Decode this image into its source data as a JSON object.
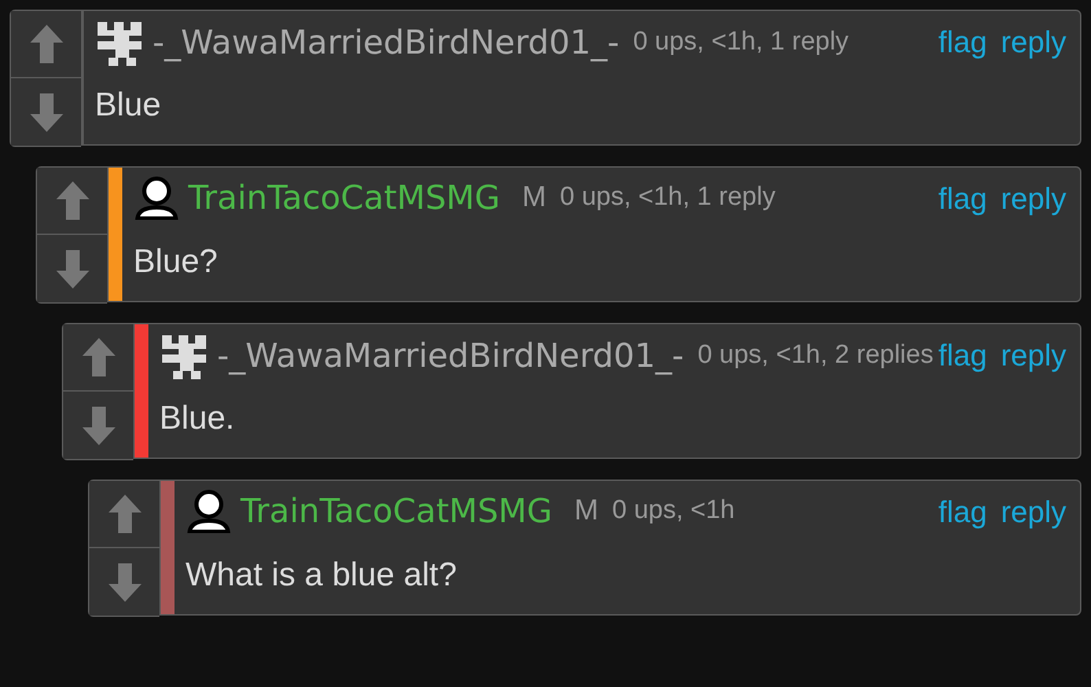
{
  "comments": [
    {
      "author": {
        "name": "-_WawaMarriedBirdNerd01_-",
        "kind": "pattern"
      },
      "meta": "0 ups, <1h, 1 reply",
      "actions": [
        "flag",
        "reply"
      ],
      "text": "Blue",
      "children": [
        {
          "author": {
            "name": "TrainTacoCatMSMG",
            "kind": "person"
          },
          "badge": "M",
          "color": "#f7931e",
          "meta": "0 ups, <1h, 1 reply",
          "actions": [
            "flag",
            "reply"
          ],
          "text": "Blue?",
          "children": [
            {
              "author": {
                "name": "-_WawaMarriedBirdNerd01_-",
                "kind": "pattern"
              },
              "color": "#f23a35",
              "meta": "0 ups, <1h, 2 replies",
              "actions": [
                "flag",
                "reply"
              ],
              "text": "Blue.",
              "children": [
                {
                  "author": {
                    "name": "TrainTacoCatMSMG",
                    "kind": "person"
                  },
                  "badge": "M",
                  "color": "#a85656",
                  "meta": "0 ups, <1h",
                  "actions": [
                    "flag",
                    "reply"
                  ],
                  "text": "What is a blue alt?"
                }
              ]
            }
          ]
        }
      ]
    }
  ]
}
